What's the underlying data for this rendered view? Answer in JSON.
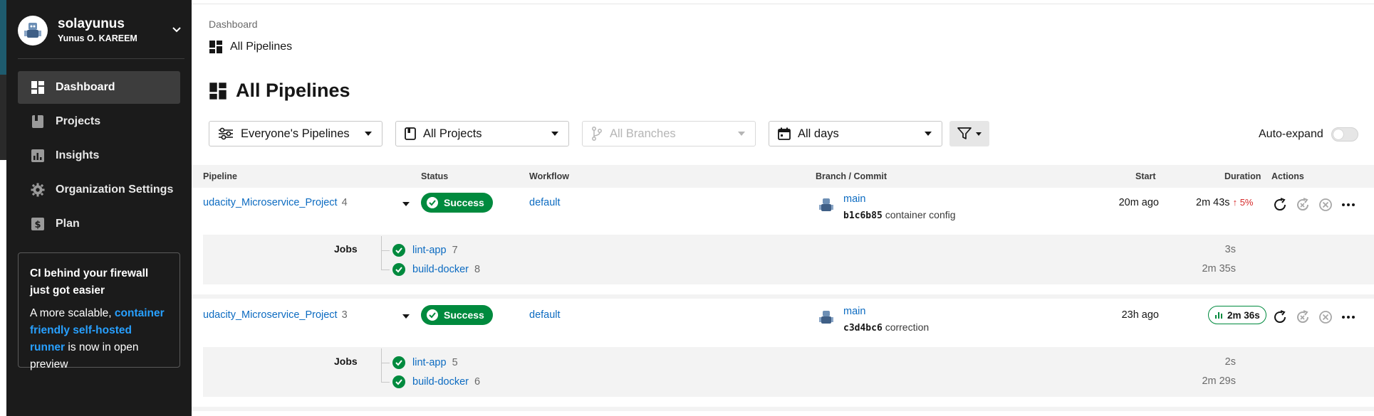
{
  "sidebar": {
    "org_name": "solayunus",
    "user_name": "Yunus O. KAREEM",
    "nav": [
      {
        "label": "Dashboard",
        "icon": "dashboard-icon",
        "active": true
      },
      {
        "label": "Projects",
        "icon": "projects-icon",
        "active": false
      },
      {
        "label": "Insights",
        "icon": "insights-icon",
        "active": false
      },
      {
        "label": "Organization Settings",
        "icon": "gear-icon",
        "active": false
      },
      {
        "label": "Plan",
        "icon": "dollar-icon",
        "active": false
      }
    ],
    "promo": {
      "title": "CI behind your firewall just got easier",
      "body_prefix": "A more scalable, ",
      "link_text": "container friendly self-hosted runner",
      "body_suffix": " is now in open preview"
    }
  },
  "header": {
    "breadcrumb": "Dashboard",
    "breadcrumb_current": "All Pipelines",
    "title": "All Pipelines"
  },
  "filters": {
    "pipelines": "Everyone's Pipelines",
    "projects": "All Projects",
    "branches": "All Branches",
    "days": "All days",
    "auto_expand_label": "Auto-expand",
    "auto_expand_on": false
  },
  "table": {
    "headers": {
      "pipeline": "Pipeline",
      "status": "Status",
      "workflow": "Workflow",
      "branch_commit": "Branch / Commit",
      "start": "Start",
      "duration": "Duration",
      "actions": "Actions"
    },
    "jobs_label": "Jobs",
    "rows": [
      {
        "project": "udacity_Microservice_Project",
        "number": "4",
        "status": "Success",
        "workflow": "default",
        "branch": "main",
        "commit_hash": "b1c6b85",
        "commit_msg": "container config",
        "start": "20m ago",
        "duration": "2m 43s",
        "duration_delta": "5%",
        "jobs": [
          {
            "name": "lint-app",
            "number": "7",
            "duration": "3s"
          },
          {
            "name": "build-docker",
            "number": "8",
            "duration": "2m 35s"
          }
        ]
      },
      {
        "project": "udacity_Microservice_Project",
        "number": "3",
        "status": "Success",
        "workflow": "default",
        "branch": "main",
        "commit_hash": "c3d4bc6",
        "commit_msg": "correction",
        "start": "23h ago",
        "duration": "2m 36s",
        "jobs": [
          {
            "name": "lint-app",
            "number": "5",
            "duration": "2s"
          },
          {
            "name": "build-docker",
            "number": "6",
            "duration": "2m 29s"
          }
        ]
      }
    ]
  },
  "colors": {
    "sidebar_bg": "#1b1b1b",
    "success": "#008a3e",
    "link": "#0c6bc1",
    "promo_link": "#28a0ff",
    "delta_up": "#d62a2a"
  }
}
